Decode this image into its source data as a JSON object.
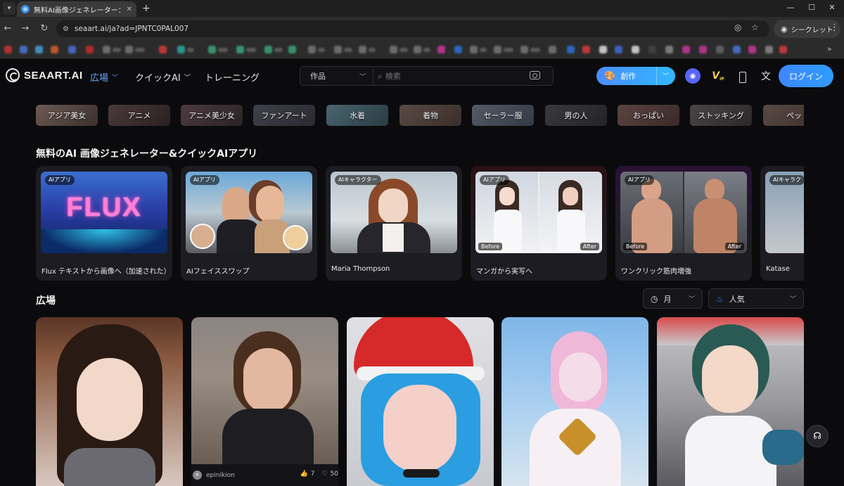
{
  "browser": {
    "tab_title": "無料AI画像ジェネレーター：テキスト",
    "url": "seaart.ai/ja?ad=JPNTC0PAL007",
    "incognito_label": "シークレット"
  },
  "header": {
    "logo_text": "SEAART.AI",
    "nav": [
      {
        "label": "広場"
      },
      {
        "label": "クイックAI"
      },
      {
        "label": "トレーニング"
      }
    ],
    "search_category": "作品",
    "search_placeholder": "検索",
    "create_label": "創作",
    "login_label": "ログイン",
    "vip_label": "V"
  },
  "chips": [
    {
      "label": "アジア美女"
    },
    {
      "label": "アニメ"
    },
    {
      "label": "アニメ美少女"
    },
    {
      "label": "ファンアート"
    },
    {
      "label": "水着"
    },
    {
      "label": "着物"
    },
    {
      "label": "セーラー服"
    },
    {
      "label": "男の人"
    },
    {
      "label": "おっぱい"
    },
    {
      "label": "ストッキング"
    },
    {
      "label": "ペッ"
    }
  ],
  "apps_section_title": "無料のAI 画像ジェネレーター&クイックAIアプリ",
  "apps": [
    {
      "badge": "AIアプリ",
      "title": "Flux テキストから画像へ（加速された）",
      "thumb_text": "FLUX"
    },
    {
      "badge": "AIアプリ",
      "title": "AIフェイススワップ"
    },
    {
      "badge": "AIキャラクター",
      "title": "Maria Thompson"
    },
    {
      "badge": "AIアプリ",
      "title": "マンガから実写へ",
      "before": "Before",
      "after": "After"
    },
    {
      "badge": "AIアプリ",
      "title": "ワンクリック筋肉増強",
      "before": "Before",
      "after": "After"
    },
    {
      "badge": "AIキャラク",
      "title": "Katase"
    }
  ],
  "gallery_section_title": "広場",
  "filters": {
    "period": "月",
    "sort": "人気"
  },
  "gallery": [
    {
      "author": "epinikion",
      "author_initial": "e",
      "likes": "7",
      "favorites": "50"
    }
  ],
  "colors": {
    "accent": "#3e86ff",
    "active_nav": "#6aa9ff",
    "background": "#0b0b0e"
  }
}
